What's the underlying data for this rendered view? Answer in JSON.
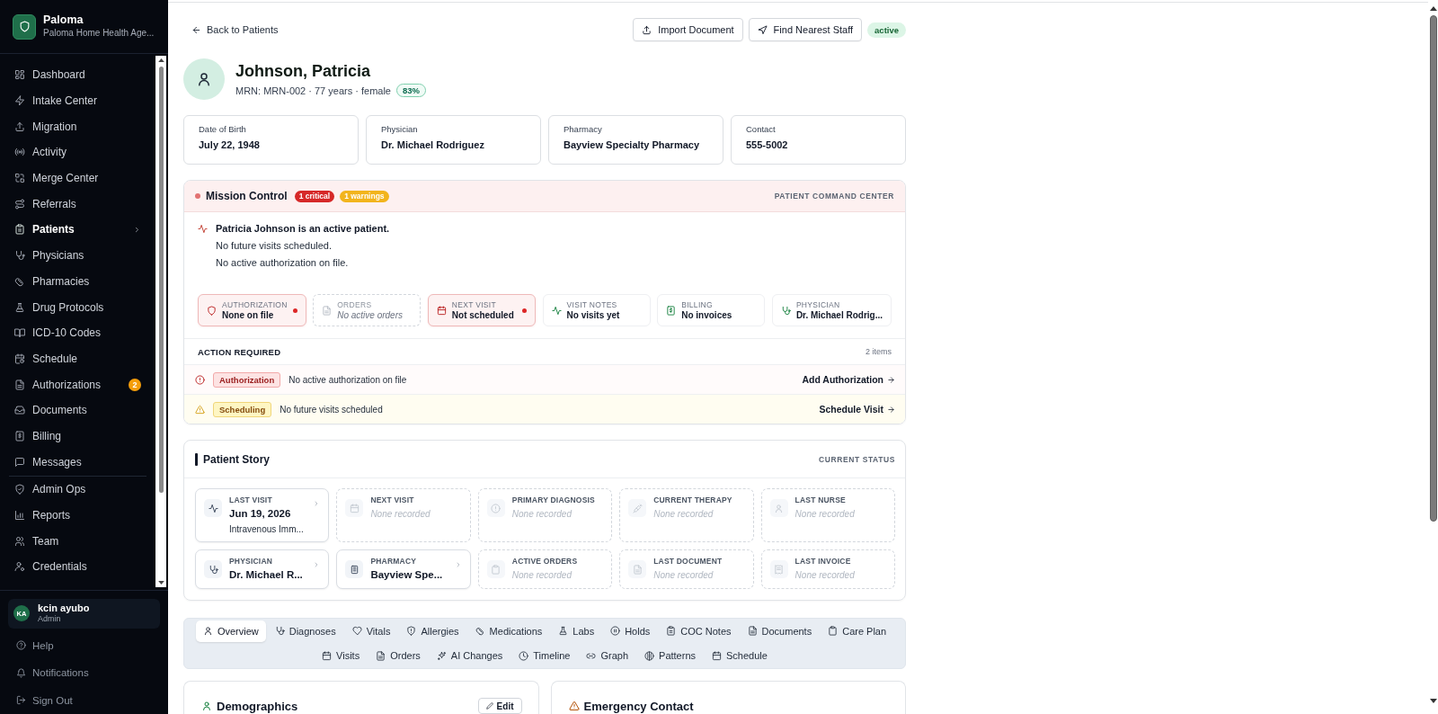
{
  "sidebar": {
    "brand": {
      "name": "Paloma",
      "subtitle": "Paloma Home Health Age..."
    },
    "nav_groups": [
      {
        "items": [
          {
            "label": "Dashboard",
            "selected": false
          },
          {
            "label": "Intake Center",
            "selected": false
          },
          {
            "label": "Migration",
            "selected": false
          },
          {
            "label": "Activity",
            "selected": false
          },
          {
            "label": "Merge Center",
            "selected": false
          },
          {
            "label": "Referrals",
            "selected": false
          },
          {
            "label": "Patients",
            "selected": true
          },
          {
            "label": "Physicians",
            "selected": false
          },
          {
            "label": "Pharmacies",
            "selected": false
          },
          {
            "label": "Drug Protocols",
            "selected": false
          },
          {
            "label": "ICD-10 Codes",
            "selected": false
          },
          {
            "label": "Schedule",
            "selected": false
          },
          {
            "label": "Authorizations",
            "selected": false,
            "badge": "2"
          },
          {
            "label": "Documents",
            "selected": false
          },
          {
            "label": "Billing",
            "selected": false
          },
          {
            "label": "Messages",
            "selected": false
          }
        ]
      },
      {
        "items": [
          {
            "label": "Admin Ops",
            "selected": false
          },
          {
            "label": "Reports",
            "selected": false
          },
          {
            "label": "Team",
            "selected": false
          },
          {
            "label": "Credentials",
            "selected": false
          }
        ]
      }
    ],
    "user": {
      "initials": "KA",
      "name": "kcin ayubo",
      "role": "Admin"
    },
    "footer_items": [
      "Help",
      "Notifications",
      "Sign Out"
    ]
  },
  "header": {
    "back_link": "Back to Patients",
    "actions": [
      "Import Document",
      "Find Nearest Staff"
    ],
    "status": "active"
  },
  "patient": {
    "name": "Johnson, Patricia",
    "meta": "MRN: MRN-002 · 77 years · female",
    "score": "83%"
  },
  "info_cards": [
    {
      "label": "Date of Birth",
      "value": "July 22, 1948"
    },
    {
      "label": "Physician",
      "value": "Dr. Michael Rodriguez"
    },
    {
      "label": "Pharmacy",
      "value": "Bayview Specialty Pharmacy"
    },
    {
      "label": "Contact",
      "value": "555-5002"
    }
  ],
  "mission_control": {
    "title": "Mission Control",
    "badges": [
      {
        "text": "1 critical",
        "kind": "critical"
      },
      {
        "text": "1 warnings",
        "kind": "warning"
      }
    ],
    "caption": "PATIENT COMMAND CENTER",
    "headline": "Patricia Johnson is an active patient.",
    "notes": [
      "No future visits scheduled.",
      "No active authorization on file."
    ],
    "tiles": [
      {
        "kind": "critical",
        "label": "AUTHORIZATION",
        "value": "None on file"
      },
      {
        "kind": "empty",
        "label": "ORDERS",
        "value": "No active orders"
      },
      {
        "kind": "critical",
        "label": "NEXT VISIT",
        "value": "Not scheduled"
      },
      {
        "kind": "ok",
        "label": "VISIT NOTES",
        "value": "No visits yet"
      },
      {
        "kind": "ok",
        "label": "BILLING",
        "value": "No invoices"
      },
      {
        "kind": "ok",
        "label": "PHYSICIAN",
        "value": "Dr. Michael Rodrig..."
      }
    ],
    "action_required": {
      "title": "ACTION REQUIRED",
      "count": "2 items",
      "items": [
        {
          "kind": "critical",
          "tag": "Authorization",
          "text": "No active authorization on file",
          "action": "Add Authorization"
        },
        {
          "kind": "warning",
          "tag": "Scheduling",
          "text": "No future visits scheduled",
          "action": "Schedule Visit"
        }
      ]
    }
  },
  "patient_story": {
    "title": "Patient Story",
    "caption": "CURRENT STATUS",
    "tiles": [
      {
        "kind": "filled",
        "label": "LAST VISIT",
        "value": "Jun 19, 2026",
        "detail": "Intravenous Imm..."
      },
      {
        "kind": "empty",
        "label": "NEXT VISIT",
        "value": "None recorded"
      },
      {
        "kind": "empty",
        "label": "PRIMARY DIAGNOSIS",
        "value": "None recorded"
      },
      {
        "kind": "empty",
        "label": "CURRENT THERAPY",
        "value": "None recorded"
      },
      {
        "kind": "empty",
        "label": "LAST NURSE",
        "value": "None recorded"
      },
      {
        "kind": "filled",
        "label": "PHYSICIAN",
        "value": "Dr. Michael R..."
      },
      {
        "kind": "filled",
        "label": "PHARMACY",
        "value": "Bayview Spe..."
      },
      {
        "kind": "empty",
        "label": "ACTIVE ORDERS",
        "value": "None recorded"
      },
      {
        "kind": "empty",
        "label": "LAST DOCUMENT",
        "value": "None recorded"
      },
      {
        "kind": "empty",
        "label": "LAST INVOICE",
        "value": "None recorded"
      }
    ]
  },
  "tabs": [
    {
      "label": "Overview",
      "selected": true
    },
    {
      "label": "Diagnoses",
      "selected": false
    },
    {
      "label": "Vitals",
      "selected": false
    },
    {
      "label": "Allergies",
      "selected": false
    },
    {
      "label": "Medications",
      "selected": false
    },
    {
      "label": "Labs",
      "selected": false
    },
    {
      "label": "Holds",
      "selected": false
    },
    {
      "label": "COC Notes",
      "selected": false
    },
    {
      "label": "Documents",
      "selected": false
    },
    {
      "label": "Care Plan",
      "selected": false
    },
    {
      "label": "Visits",
      "selected": false
    },
    {
      "label": "Orders",
      "selected": false
    },
    {
      "label": "AI Changes",
      "selected": false
    },
    {
      "label": "Timeline",
      "selected": false
    },
    {
      "label": "Graph",
      "selected": false
    },
    {
      "label": "Patterns",
      "selected": false
    },
    {
      "label": "Schedule",
      "selected": false
    }
  ],
  "panels": [
    {
      "title": "Demographics",
      "action": "Edit"
    },
    {
      "title": "Emergency Contact"
    }
  ]
}
